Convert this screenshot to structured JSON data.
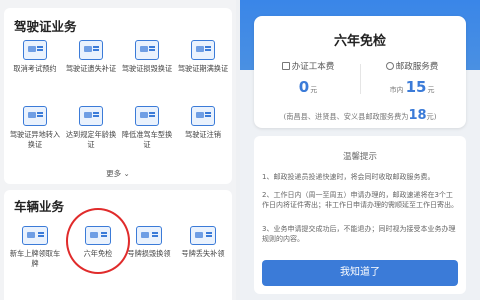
{
  "left": {
    "section1": {
      "title": "驾驶证业务",
      "items": [
        "取消考试预约",
        "驾驶证遗失补证",
        "驾驶证损毁换证",
        "驾驶证期满换证",
        "驾驶证异地转入换证",
        "达到规定年龄换证",
        "降低准驾车型换证",
        "驾驶证注销"
      ],
      "more": "更多 ⌄"
    },
    "section2": {
      "title": "车辆业务",
      "items": [
        "新车上牌领取车牌",
        "六年免检",
        "号牌损毁换领",
        "号牌丢失补领"
      ]
    }
  },
  "right": {
    "title": "六年免检",
    "fee1": {
      "label": "办证工本费",
      "value": "0",
      "unit": "元"
    },
    "fee2": {
      "label": "邮政服务费",
      "prefix": "市内",
      "value": "15",
      "unit": "元"
    },
    "note": {
      "text": "(南昌县、进贤县、安义县邮政服务费为",
      "value": "18",
      "suffix": "元)"
    },
    "tips_title": "温馨提示",
    "tips": [
      "1、邮政投递员投递快速时，将会同时收取邮政服务费。",
      "2、工作日内（周一至周五）申请办理的，邮政速递将在3个工作日内将证件寄出；非工作日申请办理的需顺延至工作日寄出。",
      "3、业务申请提交成功后，不能退办；同时视为接受本业务办理规则的内容。"
    ],
    "button": "我知道了"
  }
}
